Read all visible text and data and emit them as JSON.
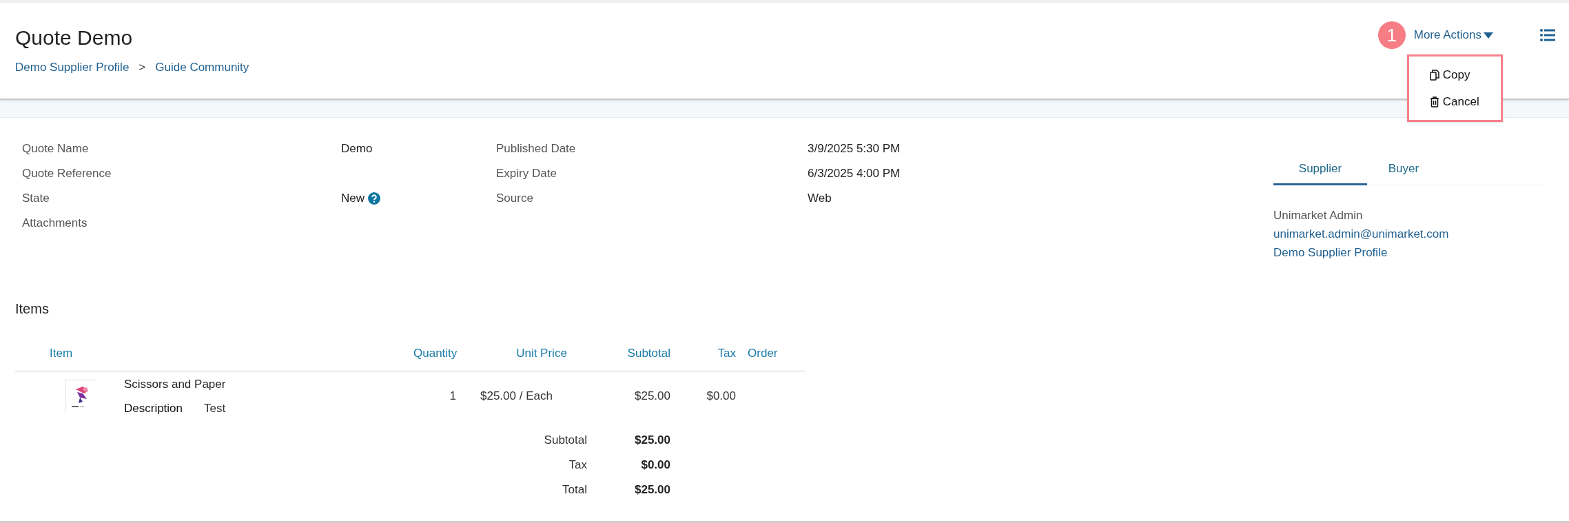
{
  "header": {
    "title": "Quote Demo",
    "breadcrumbs": [
      "Demo Supplier Profile",
      "Guide Community"
    ],
    "separator": ">"
  },
  "step_badge": "1",
  "more_actions": {
    "label": "More Actions",
    "expanded": true,
    "menu": [
      {
        "label": "Copy",
        "kind": "copy"
      },
      {
        "label": "Cancel",
        "kind": "cancel"
      }
    ]
  },
  "details": [
    {
      "label": "Quote Name",
      "value": "Demo"
    },
    {
      "label": "Published Date",
      "value": "3/9/2025 5:30 PM"
    },
    {
      "label": "Quote Reference"
    },
    {
      "label": "Expiry Date",
      "value": "6/3/2025 4:00 PM"
    },
    {
      "label": "State",
      "value": "New",
      "help": true
    },
    {
      "label": "Source",
      "value": "Web"
    },
    {
      "label": "Attachments"
    }
  ],
  "party_tabs": [
    {
      "label": "Supplier",
      "selected": true
    },
    {
      "label": "Buyer",
      "selected": false
    }
  ],
  "contact": {
    "name": "Unimarket Admin",
    "email": "unimarket.admin@unimarket.com",
    "profile": "Demo Supplier Profile"
  },
  "items": {
    "title": "Items",
    "columns": [
      "Item",
      "Quantity",
      "Unit Price",
      "Subtotal",
      "Tax",
      "Order"
    ],
    "rows": [
      {
        "kind": "picture",
        "name": "Scissors and Paper",
        "description_label": "Description",
        "description": "Test",
        "quantity": "1",
        "unit_price": "$25.00 / Each",
        "subtotal": "$25.00",
        "tax": "$0.00"
      }
    ],
    "totals": [
      {
        "label": "Subtotal",
        "value": "$25.00"
      },
      {
        "label": "Tax",
        "value": "$0.00"
      },
      {
        "label": "Total",
        "value": "$25.00"
      }
    ]
  }
}
